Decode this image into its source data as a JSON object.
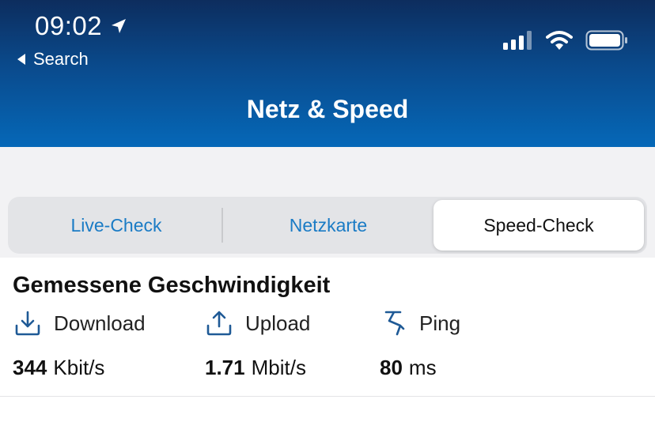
{
  "status_bar": {
    "time": "09:02",
    "back_label": "Search",
    "icons": [
      "location-arrow-icon",
      "signal-bars-icon",
      "wifi-icon",
      "battery-icon"
    ]
  },
  "nav": {
    "title": "Netz & Speed"
  },
  "tabs": [
    {
      "label": "Live-Check",
      "selected": false
    },
    {
      "label": "Netzkarte",
      "selected": false
    },
    {
      "label": "Speed-Check",
      "selected": true
    }
  ],
  "measurement": {
    "title": "Gemessene Geschwindigkeit",
    "download": {
      "label": "Download",
      "value": "344",
      "unit": "Kbit/s",
      "icon": "download-icon"
    },
    "upload": {
      "label": "Upload",
      "value": "1.71",
      "unit": "Mbit/s",
      "icon": "upload-icon"
    },
    "ping": {
      "label": "Ping",
      "value": "80",
      "unit": "ms",
      "icon": "ping-icon"
    }
  },
  "colors": {
    "header_top": "#0d2d5e",
    "header_bottom": "#0568b8",
    "tab_link": "#1a7bc5",
    "icon_blue": "#1f5a96"
  }
}
